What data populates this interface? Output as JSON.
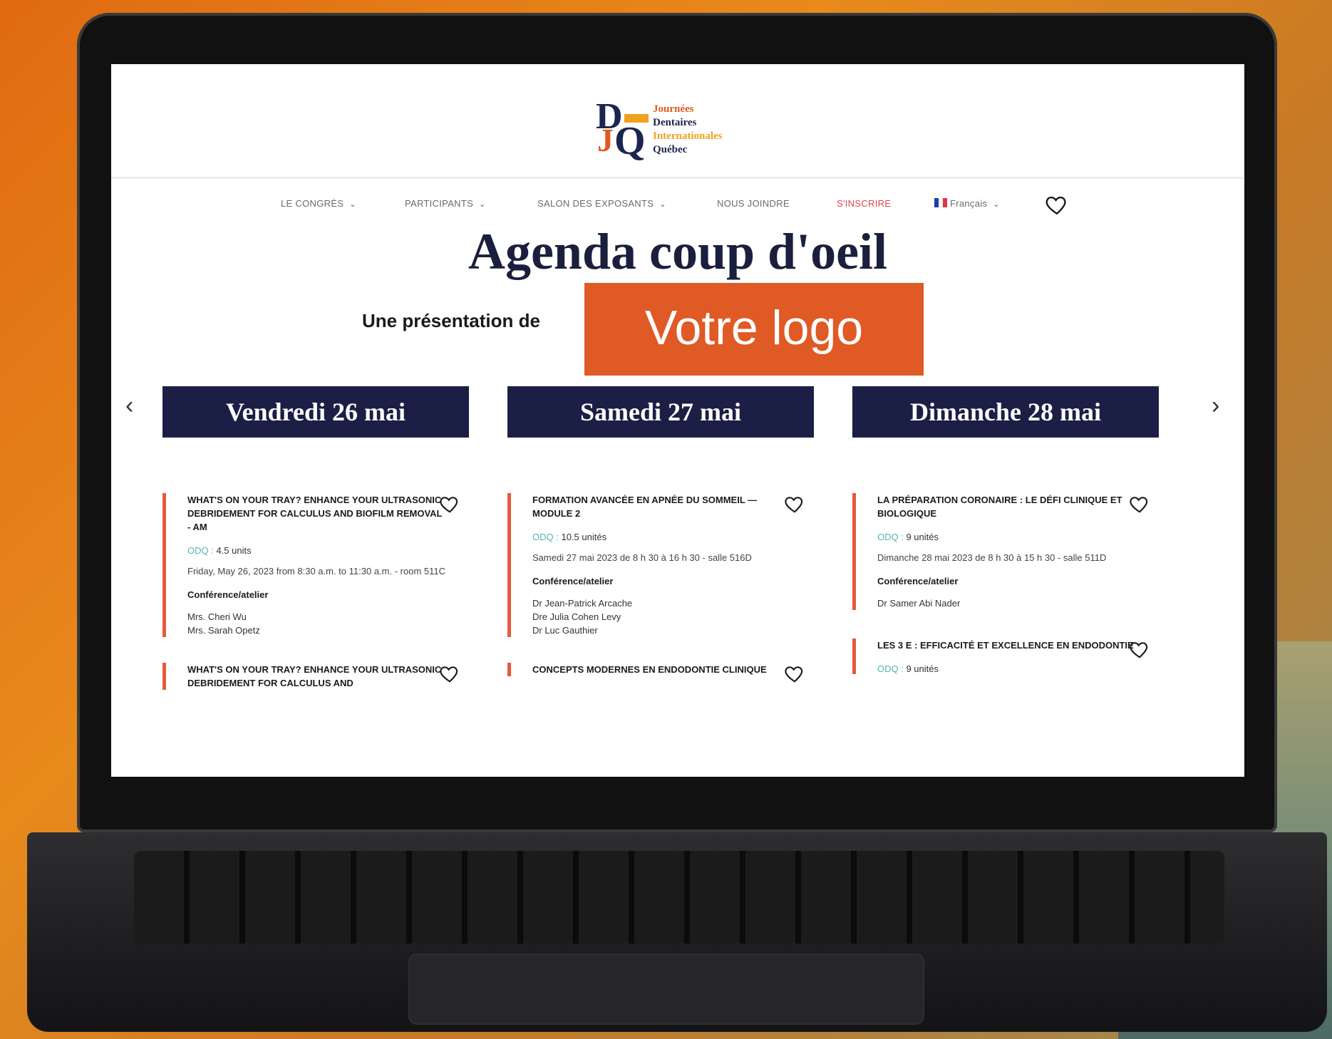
{
  "brand": {
    "letters": {
      "d": "D",
      "j": "J",
      "q": "Q"
    },
    "lines": [
      "Journées",
      "Dentaires",
      "Internationales",
      "Québec"
    ],
    "colors": {
      "navy": "#1c2450",
      "orange": "#e05a1f",
      "gold": "#f0a11e"
    }
  },
  "nav": {
    "items": [
      {
        "label": "LE CONGRÈS",
        "has_dropdown": true
      },
      {
        "label": "PARTICIPANTS",
        "has_dropdown": true
      },
      {
        "label": "SALON DES EXPOSANTS",
        "has_dropdown": true
      },
      {
        "label": "NOUS JOINDRE",
        "has_dropdown": false
      },
      {
        "label": "S'INSCRIRE",
        "has_dropdown": false
      }
    ],
    "language": "Français",
    "chevron": "⌄",
    "favorites_icon": "heart-icon"
  },
  "page": {
    "title": "Agenda coup d'oeil",
    "presented_by": "Une présentation de",
    "sponsor_logo_text": "Votre logo"
  },
  "carousel": {
    "prev": "‹",
    "next": "›"
  },
  "days": [
    {
      "label": "Vendredi 26 mai",
      "events": [
        {
          "title": "WHAT'S ON YOUR TRAY? ENHANCE YOUR ULTRASONIC DEBRIDEMENT FOR CALCULUS AND BIOFILM REMOVAL - AM",
          "odq": "ODQ :",
          "units": "4.5 units",
          "when": "Friday, May 26, 2023 from 8:30 a.m. to 11:30 a.m. - room 511C",
          "type": "Conférence/atelier",
          "speakers": [
            "Mrs. Cheri Wu",
            "Mrs. Sarah Opetz"
          ]
        },
        {
          "title": "WHAT'S ON YOUR TRAY? ENHANCE YOUR ULTRASONIC DEBRIDEMENT FOR CALCULUS AND"
        }
      ]
    },
    {
      "label": "Samedi 27 mai",
      "events": [
        {
          "title": "FORMATION AVANCÉE EN APNÉE DU SOMMEIL — MODULE 2",
          "odq": "ODQ :",
          "units": "10.5 unités",
          "when": "Samedi 27 mai 2023 de 8 h 30 à 16 h 30 - salle 516D",
          "type": "Conférence/atelier",
          "speakers": [
            "Dr Jean-Patrick Arcache",
            "Dre Julia Cohen Levy",
            "Dr Luc Gauthier"
          ]
        },
        {
          "title": "CONCEPTS MODERNES EN ENDODONTIE CLINIQUE"
        }
      ]
    },
    {
      "label": "Dimanche 28 mai",
      "events": [
        {
          "title": "LA PRÉPARATION CORONAIRE : LE DÉFI CLINIQUE ET BIOLOGIQUE",
          "odq": "ODQ :",
          "units": "9 unités",
          "when": "Dimanche 28 mai 2023 de 8 h 30 à 15 h 30 - salle 511D",
          "type": "Conférence/atelier",
          "speakers": [
            "Dr Samer Abi Nader"
          ]
        },
        {
          "title": "LES 3 E : EFFICACITÉ ET EXCELLENCE EN ENDODONTIE",
          "odq": "ODQ :",
          "units": "9 unités"
        }
      ]
    }
  ],
  "colors": {
    "accent": "#df5a25",
    "navy": "#1b1f46",
    "event_bar": "#e45a3c",
    "odq": "#55b5b2",
    "signup": "#e0434b"
  }
}
